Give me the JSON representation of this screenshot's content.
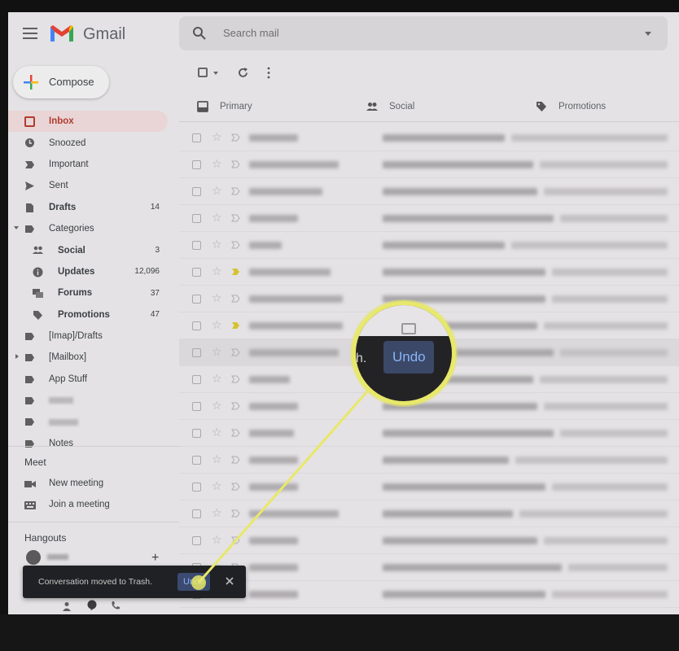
{
  "app": {
    "brand": "Gmail",
    "search_placeholder": "Search mail"
  },
  "compose": {
    "label": "Compose"
  },
  "nav": {
    "inbox": {
      "label": "Inbox"
    },
    "snoozed": {
      "label": "Snoozed"
    },
    "important": {
      "label": "Important"
    },
    "sent": {
      "label": "Sent"
    },
    "drafts": {
      "label": "Drafts",
      "count": "14"
    },
    "categories": {
      "label": "Categories"
    },
    "social": {
      "label": "Social",
      "count": "3"
    },
    "updates": {
      "label": "Updates",
      "count": "12,096"
    },
    "forums": {
      "label": "Forums",
      "count": "37"
    },
    "promotions": {
      "label": "Promotions",
      "count": "47"
    },
    "imap_drafts": {
      "label": "[Imap]/Drafts"
    },
    "mailbox": {
      "label": "[Mailbox]"
    },
    "app_stuff": {
      "label": "App Stuff"
    },
    "notes": {
      "label": "Notes"
    }
  },
  "meet": {
    "title": "Meet",
    "new_meeting": "New meeting",
    "join_meeting": "Join a meeting"
  },
  "hangouts": {
    "title": "Hangouts"
  },
  "tabs": {
    "primary": "Primary",
    "social": "Social",
    "promotions": "Promotions"
  },
  "toast": {
    "message": "Conversation moved to Trash.",
    "undo": "Undo"
  },
  "magnifier": {
    "text_fragment": "h.",
    "undo": "Undo"
  },
  "colors": {
    "accent_red": "#b23b2e",
    "highlight_yellow": "#e8e86a",
    "link_blue": "#8ab4f8"
  }
}
